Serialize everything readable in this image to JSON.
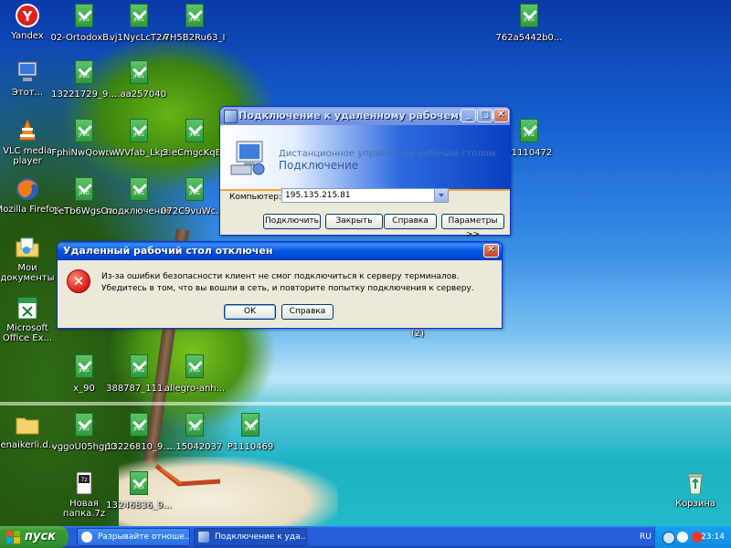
{
  "desktop": {
    "icons": [
      {
        "label": "Yandex",
        "kind": "yandex"
      },
      {
        "label": "02-OrtodoxB...",
        "kind": "jpeg"
      },
      {
        "label": "vj1NycLcT2A",
        "kind": "jpeg"
      },
      {
        "label": "7H5B2Ru63_I",
        "kind": "jpeg"
      },
      {
        "label": "762a5442b0...",
        "kind": "jpeg"
      },
      {
        "label": "Этот...",
        "kind": "computer"
      },
      {
        "label": "13221729_9...",
        "kind": "jpeg"
      },
      {
        "label": "...aa257040",
        "kind": "jpeg"
      },
      {
        "label": "VLC media player",
        "kind": "vlc"
      },
      {
        "label": "FphiNwQowrw",
        "kind": "jpeg"
      },
      {
        "label": "...WVfab_Lkpc",
        "kind": "jpeg"
      },
      {
        "label": "3-eCmgcKqEY",
        "kind": "jpeg"
      },
      {
        "label": "P1110472",
        "kind": "jpeg"
      },
      {
        "label": "Mozilla Firefox",
        "kind": "firefox"
      },
      {
        "label": "1eTb6WgsOw",
        "kind": "jpeg"
      },
      {
        "label": "подключение",
        "kind": "jpeg"
      },
      {
        "label": "072C9vuWcd...",
        "kind": "jpeg"
      },
      {
        "label": "Мои документы",
        "kind": "mydocs"
      },
      {
        "label": "Microsoft Office Ex...",
        "kind": "excel"
      },
      {
        "label": "(2)",
        "kind": "caption"
      },
      {
        "label": "x_90",
        "kind": "jpeg"
      },
      {
        "label": "388787_111...",
        "kind": "jpeg"
      },
      {
        "label": "allegro-anh...",
        "kind": "jpeg"
      },
      {
        "label": "lenaikerli.d...",
        "kind": "folder"
      },
      {
        "label": "vggoU05hgp0",
        "kind": "jpeg"
      },
      {
        "label": "13226810_9...",
        "kind": "jpeg"
      },
      {
        "label": "...15042037",
        "kind": "jpeg"
      },
      {
        "label": "P1110469",
        "kind": "jpeg"
      },
      {
        "label": "Новая папка.7z",
        "kind": "archive"
      },
      {
        "label": "13246836_9...",
        "kind": "jpeg"
      },
      {
        "label": "Корзина",
        "kind": "recycle"
      }
    ]
  },
  "rdp_window": {
    "title": "Подключение к удаленному рабочему столу",
    "banner_line1": "Дистанционное управление рабочим столом",
    "banner_line2": "Подключение",
    "computer_label": "Компьютер:",
    "computer_value": "195.135.215.81",
    "buttons": {
      "connect": "Подключить",
      "cancel": "Закрыть",
      "help": "Справка",
      "options": "Параметры >>"
    },
    "minimize": "_",
    "maximize": "□",
    "close": "✕"
  },
  "error_dialog": {
    "title": "Удаленный рабочий стол отключен",
    "message": "Из-за ошибки безопасности клиент не смог подключиться к серверу терминалов. Убедитесь в том, что вы вошли в сеть, и повторите попытку подключения к серверу.",
    "ok": "OK",
    "help": "Справка",
    "close": "✕",
    "icon": "error-icon"
  },
  "taskbar": {
    "start_label": "пуск",
    "items": [
      {
        "label": "Разрывайте отноше...",
        "icon": "yandex-browser-icon"
      },
      {
        "label": "Подключение к уда...",
        "icon": "rdp-icon"
      }
    ],
    "language": "RU",
    "clock": "23:14"
  },
  "colors": {
    "xp_blue": "#0055e5",
    "taskbar": "#245edb",
    "start_green": "#3c9b35",
    "dialog_bg": "#ece9d8"
  }
}
